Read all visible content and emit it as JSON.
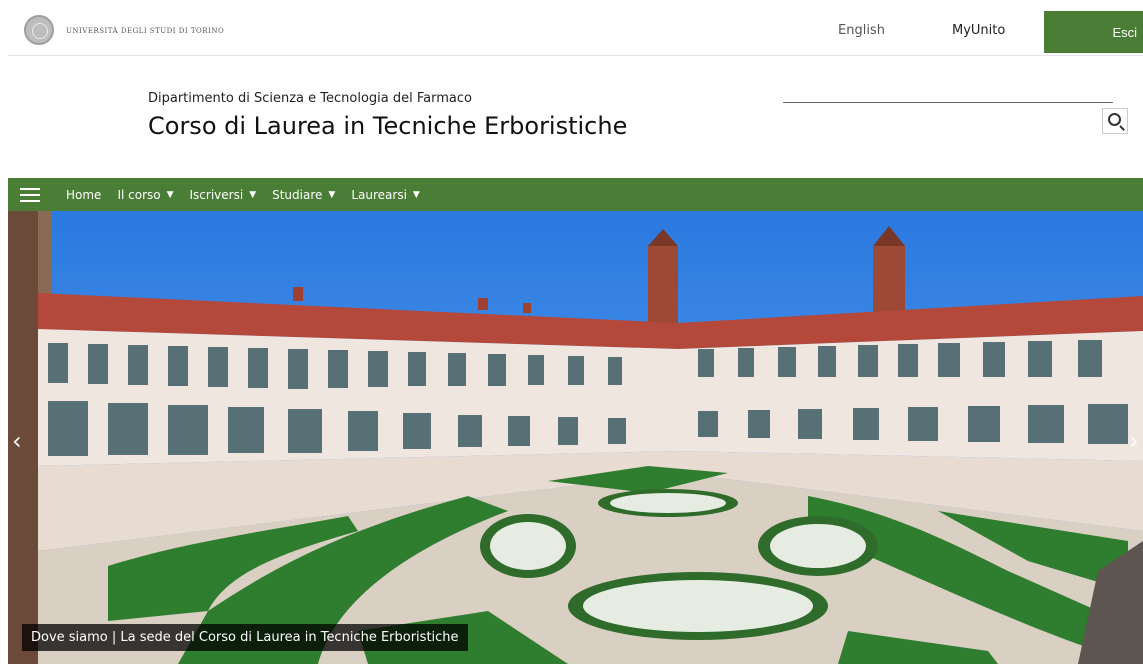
{
  "topbar": {
    "university": "UNIVERSITÀ DEGLI STUDI DI TORINO",
    "lang_link": "English",
    "myunito_link": "MyUnito",
    "logout_label": "Esci"
  },
  "header": {
    "department": "Dipartimento di Scienza e Tecnologia del Farmaco",
    "course_title": "Corso di Laurea in Tecniche Erboristiche",
    "search_placeholder": ""
  },
  "nav": {
    "items": [
      {
        "label": "Home",
        "dropdown": false
      },
      {
        "label": "Il corso",
        "dropdown": true
      },
      {
        "label": "Iscriversi",
        "dropdown": true
      },
      {
        "label": "Studiare",
        "dropdown": true
      },
      {
        "label": "Laurearsi",
        "dropdown": true
      }
    ],
    "caret": "▼"
  },
  "hero": {
    "caption": "Dove siamo | La sede del Corso di Laurea in Tecniche Erboristiche",
    "prev_icon": "chevron-left",
    "next_icon": "chevron-right"
  },
  "colors": {
    "brand_green": "#4a7d35",
    "sky": "#3a86e6",
    "roof": "#b4483a",
    "lawn": "#2f7d2e"
  }
}
